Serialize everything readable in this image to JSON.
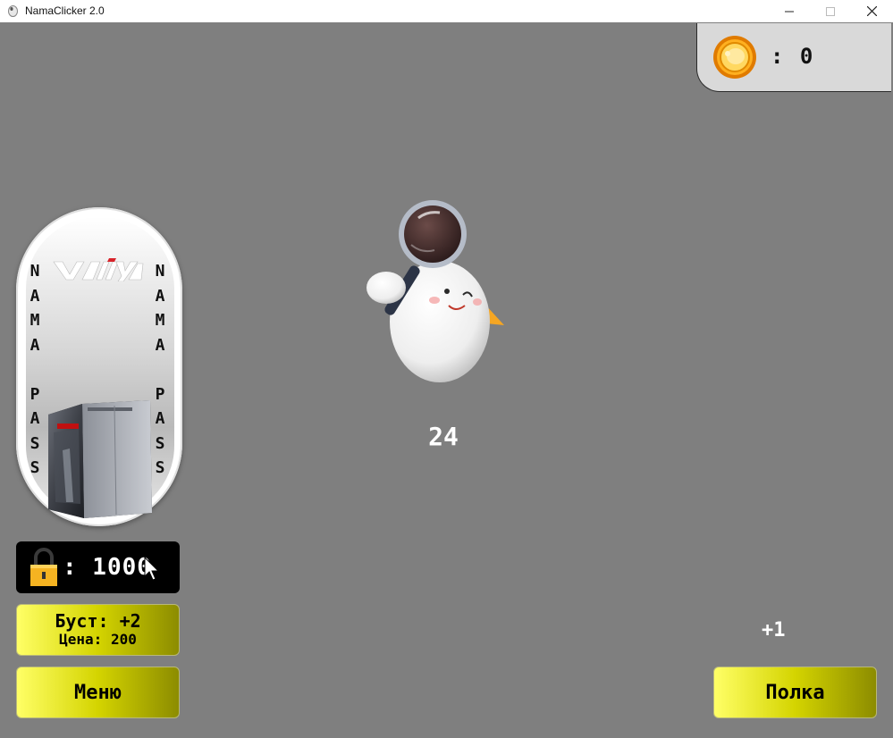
{
  "window": {
    "title": "NamaClicker 2.0",
    "controls": {
      "minimize": "—",
      "maximize": "☐",
      "close": "✕"
    }
  },
  "coins": {
    "label": ": 0",
    "icon": "coin-icon"
  },
  "nama_pass": {
    "letters_left": "N\nA\nM\nA\n\nP\nA\nS\nS",
    "letters_right": "N\nA\nM\nA\n\nP\nA\nS\nS",
    "logo_text": "valiya"
  },
  "lock": {
    "price": ": 1000",
    "icon": "lock-icon"
  },
  "boost": {
    "line1": "Буст: +2",
    "line2": "Цена: 200"
  },
  "menu_label": "Меню",
  "shelf_label": "Полка",
  "click_count": "24",
  "floating_gain": "+1",
  "colors": {
    "background": "#7f7f7f",
    "button_yellow": "#ffff66",
    "button_olive": "#8c8c00",
    "coin_panel": "#d9d9d9"
  }
}
